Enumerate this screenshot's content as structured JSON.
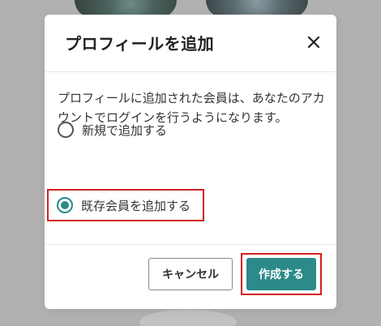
{
  "background": {
    "overlay_color": "#b1b1b1"
  },
  "modal": {
    "title": "プロフィールを追加",
    "close_icon": "close-icon",
    "description": "プロフィールに追加された会員は、あなたのアカウントでログインを行うようになります。",
    "options": [
      {
        "label": "新規で追加する",
        "selected": false
      },
      {
        "label": "既存会員を追加する",
        "selected": true
      }
    ],
    "buttons": {
      "cancel_label": "キャンセル",
      "create_label": "作成する"
    },
    "accent_color": "#2c8a8a",
    "highlight_color": "#d21f1f"
  }
}
